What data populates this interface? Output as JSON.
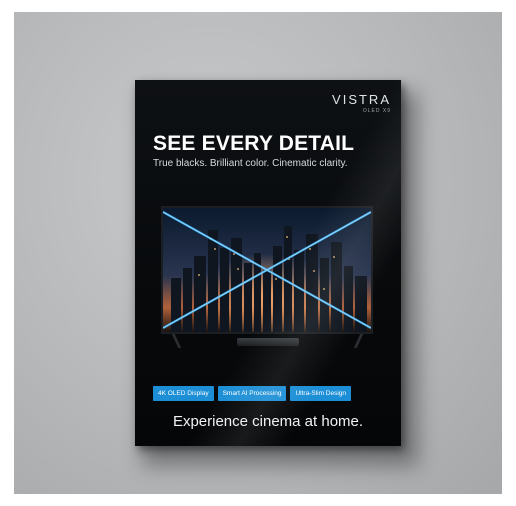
{
  "poster": {
    "brand": "VISTRA",
    "model": "OLED X9",
    "headline": "SEE EVERY DETAIL",
    "subheadline": "True blacks. Brilliant color. Cinematic clarity.",
    "features": [
      "4K OLED Display",
      "Smart AI Processing",
      "Ultra-Slim Design"
    ],
    "tagline": "Experience cinema at home."
  },
  "colors": {
    "accent": "#1d8fd6",
    "poster_bg": "#07090b",
    "wall": "#b8babc",
    "light_beam": "#3fb8ff"
  }
}
